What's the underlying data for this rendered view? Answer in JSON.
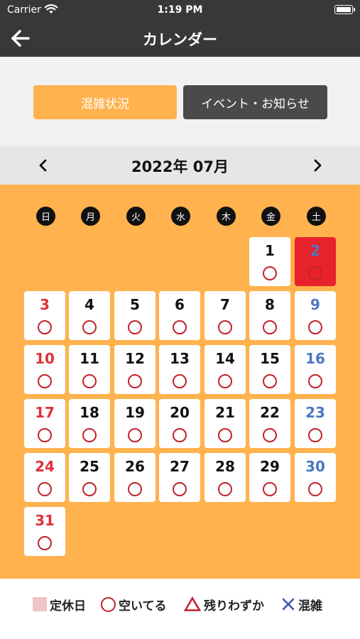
{
  "status_bar": {
    "carrier": "Carrier",
    "time": "1:19 PM"
  },
  "nav": {
    "title": "カレンダー",
    "back_icon": "back-arrow-icon"
  },
  "tabs": {
    "congestion": "混雑状況",
    "events": "イベント・お知らせ"
  },
  "month": {
    "label": "2022年 07月",
    "prev_icon": "chevron-left-icon",
    "next_icon": "chevron-right-icon"
  },
  "weekdays": [
    "日",
    "月",
    "火",
    "水",
    "木",
    "金",
    "土"
  ],
  "first_weekday_index": 5,
  "days": [
    {
      "d": "1",
      "status": "open"
    },
    {
      "d": "2",
      "status": "open",
      "closed": true
    },
    {
      "d": "3",
      "status": "open"
    },
    {
      "d": "4",
      "status": "open"
    },
    {
      "d": "5",
      "status": "open"
    },
    {
      "d": "6",
      "status": "open"
    },
    {
      "d": "7",
      "status": "open"
    },
    {
      "d": "8",
      "status": "open"
    },
    {
      "d": "9",
      "status": "open"
    },
    {
      "d": "10",
      "status": "open"
    },
    {
      "d": "11",
      "status": "open"
    },
    {
      "d": "12",
      "status": "open"
    },
    {
      "d": "13",
      "status": "open"
    },
    {
      "d": "14",
      "status": "open"
    },
    {
      "d": "15",
      "status": "open"
    },
    {
      "d": "16",
      "status": "open"
    },
    {
      "d": "17",
      "status": "open"
    },
    {
      "d": "18",
      "status": "open"
    },
    {
      "d": "19",
      "status": "open"
    },
    {
      "d": "20",
      "status": "open"
    },
    {
      "d": "21",
      "status": "open"
    },
    {
      "d": "22",
      "status": "open"
    },
    {
      "d": "23",
      "status": "open"
    },
    {
      "d": "24",
      "status": "open"
    },
    {
      "d": "25",
      "status": "open"
    },
    {
      "d": "26",
      "status": "open"
    },
    {
      "d": "27",
      "status": "open"
    },
    {
      "d": "28",
      "status": "open"
    },
    {
      "d": "29",
      "status": "open"
    },
    {
      "d": "30",
      "status": "open"
    },
    {
      "d": "31",
      "status": "open"
    }
  ],
  "legend": {
    "closed": "定休日",
    "open": "空いてる",
    "few_left": "残りわずか",
    "busy": "混雑"
  },
  "colors": {
    "header_bg": "#3a3836",
    "accent_orange": "#ffb24e",
    "holiday_red": "#e8222a",
    "sunday_red": "#e0313a",
    "saturday_blue": "#4a78c2",
    "status_red": "#c2222c",
    "busy_blue": "#3a56b0",
    "closed_pink": "#f0c4c4"
  }
}
